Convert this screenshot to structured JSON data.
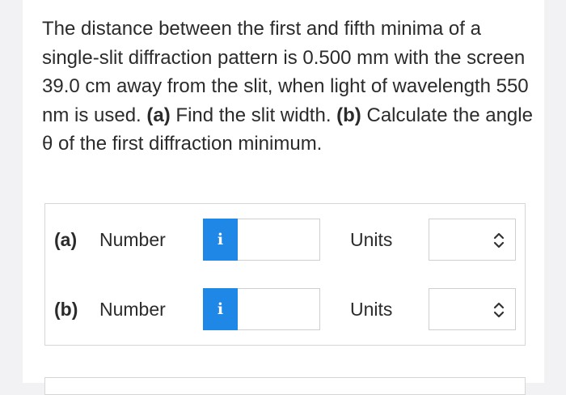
{
  "question": {
    "text_1": "The distance between the first and fifth minima of a single-slit diffraction pattern is 0.500 mm with the screen 39.0 cm away from the slit, when light of wavelength 550 nm is used. ",
    "part_a_marker": "(a)",
    "text_2": " Find the slit width. ",
    "part_b_marker": "(b)",
    "text_3": " Calculate the angle θ of the first diffraction minimum."
  },
  "answers": [
    {
      "part": "(a)",
      "number_label": "Number",
      "info_glyph": "i",
      "value": "",
      "units_label": "Units",
      "units_value": ""
    },
    {
      "part": "(b)",
      "number_label": "Number",
      "info_glyph": "i",
      "value": "",
      "units_label": "Units",
      "units_value": ""
    }
  ],
  "colors": {
    "accent": "#1f87e5",
    "text": "#2b2b2b",
    "border": "#d6d6d6"
  },
  "icons": {
    "info": "info-icon",
    "select": "chevron-updown-icon"
  }
}
